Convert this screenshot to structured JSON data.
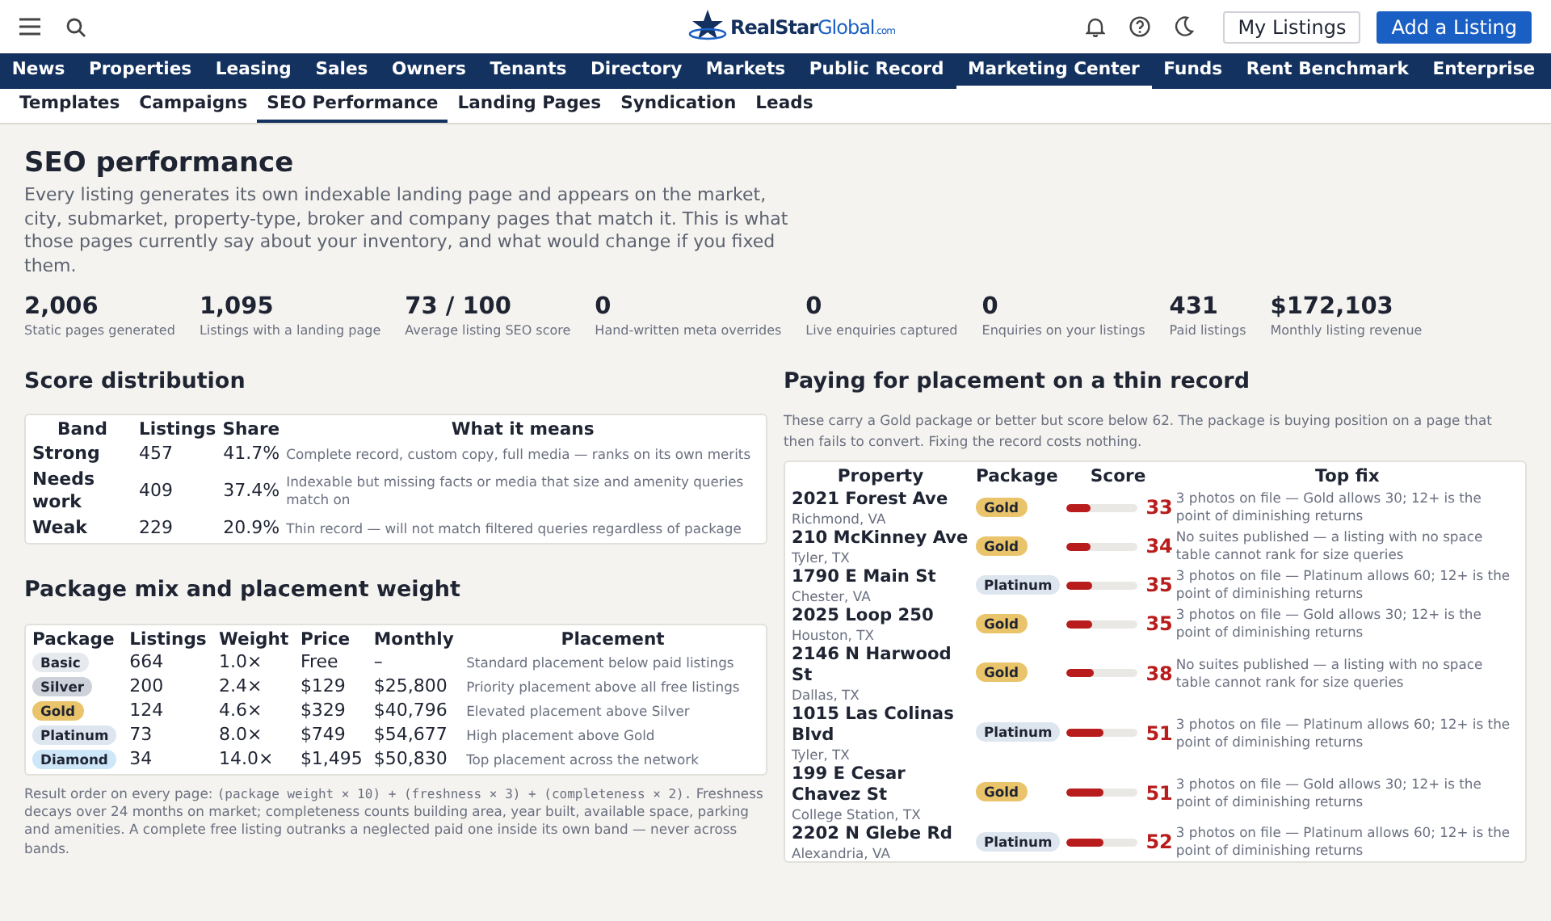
{
  "header": {
    "logo": {
      "name": "RealStar",
      "accent": "Global",
      "suffix": ".com"
    },
    "buttons": [
      {
        "label": "My Listings",
        "kind": "outline"
      },
      {
        "label": "Add a Listing",
        "kind": "primary"
      }
    ]
  },
  "nav": [
    {
      "label": "News",
      "selected": false
    },
    {
      "label": "Properties",
      "selected": false
    },
    {
      "label": "Leasing",
      "selected": false
    },
    {
      "label": "Sales",
      "selected": false
    },
    {
      "label": "Owners",
      "selected": false
    },
    {
      "label": "Tenants",
      "selected": false
    },
    {
      "label": "Directory",
      "selected": false
    },
    {
      "label": "Markets",
      "selected": false
    },
    {
      "label": "Public Record",
      "selected": false
    },
    {
      "label": "Marketing Center",
      "selected": true
    },
    {
      "label": "Funds",
      "selected": false
    },
    {
      "label": "Rent Benchmark",
      "selected": false
    },
    {
      "label": "Enterprise",
      "selected": false
    }
  ],
  "subnav": [
    {
      "label": "Templates",
      "selected": false
    },
    {
      "label": "Campaigns",
      "selected": false
    },
    {
      "label": "SEO Performance",
      "selected": true
    },
    {
      "label": "Landing Pages",
      "selected": false
    },
    {
      "label": "Syndication",
      "selected": false
    },
    {
      "label": "Leads",
      "selected": false
    }
  ],
  "page": {
    "title": "SEO performance",
    "description": "Every listing generates its own indexable landing page and appears on the market, city, submarket, property-type, broker and company pages that match it. This is what those pages currently say about your inventory, and what would change if you fixed them."
  },
  "stats": [
    {
      "value": "2,006",
      "label": "Static pages generated"
    },
    {
      "value": "1,095",
      "label": "Listings with a landing page"
    },
    {
      "value": "73 / 100",
      "label": "Average listing SEO score"
    },
    {
      "value": "0",
      "label": "Hand-written meta overrides"
    },
    {
      "value": "0",
      "label": "Live enquiries captured"
    },
    {
      "value": "0",
      "label": "Enquiries on your listings"
    },
    {
      "value": "431",
      "label": "Paid listings"
    },
    {
      "value": "$172,103",
      "label": "Monthly listing revenue"
    }
  ],
  "score_distribution": {
    "title": "Score distribution",
    "columns": [
      "Band",
      "Listings",
      "Share",
      "What it means"
    ],
    "rows": [
      {
        "band": "Strong",
        "listings": "457",
        "share": "41.7%",
        "meaning": "Complete record, custom copy, full media — ranks on its own merits"
      },
      {
        "band": "Needs work",
        "listings": "409",
        "share": "37.4%",
        "meaning": "Indexable but missing facts or media that size and amenity queries match on"
      },
      {
        "band": "Weak",
        "listings": "229",
        "share": "20.9%",
        "meaning": "Thin record — will not match filtered queries regardless of package"
      }
    ]
  },
  "package_mix": {
    "title": "Package mix and placement weight",
    "columns": [
      "Package",
      "Listings",
      "Weight",
      "Price",
      "Monthly",
      "Placement"
    ],
    "rows": [
      {
        "package": "Basic",
        "kind": "basic",
        "listings": "664",
        "weight": "1.0×",
        "price": "Free",
        "monthly": "–",
        "placement": "Standard placement below paid listings"
      },
      {
        "package": "Silver",
        "kind": "silver",
        "listings": "200",
        "weight": "2.4×",
        "price": "$129",
        "monthly": "$25,800",
        "placement": "Priority placement above all free listings"
      },
      {
        "package": "Gold",
        "kind": "gold",
        "listings": "124",
        "weight": "4.6×",
        "price": "$329",
        "monthly": "$40,796",
        "placement": "Elevated placement above Silver"
      },
      {
        "package": "Platinum",
        "kind": "platinum",
        "listings": "73",
        "weight": "8.0×",
        "price": "$749",
        "monthly": "$54,677",
        "placement": "High placement above Gold"
      },
      {
        "package": "Diamond",
        "kind": "diamond",
        "listings": "34",
        "weight": "14.0×",
        "price": "$1,495",
        "monthly": "$50,830",
        "placement": "Top placement across the network"
      }
    ],
    "note": {
      "lead": "Result order on every page:",
      "formula": "(package weight × 10) + (freshness × 3) + (completeness × 2).",
      "text": "Freshness decays over 24 months on market; completeness counts building area, year built, available space, parking and amenities. A complete free listing outranks a neglected paid one inside its own band — never across bands."
    }
  },
  "thin_records": {
    "title": "Paying for placement on a thin record",
    "description": "These carry a Gold package or better but score below 62. The package is buying position on a page that then fails to convert. Fixing the record costs nothing.",
    "columns": [
      "Property",
      "Package",
      "Score",
      "Top fix"
    ],
    "rows": [
      {
        "property": "2021 Forest Ave",
        "city": "Richmond, VA",
        "package": "Gold",
        "kind": "gold",
        "level": 0.33,
        "score": "33",
        "fix": "3 photos on file — Gold allows 30; 12+ is the point of diminishing returns"
      },
      {
        "property": "210 McKinney Ave",
        "city": "Tyler, TX",
        "package": "Gold",
        "kind": "gold",
        "level": 0.34,
        "score": "34",
        "fix": "No suites published — a listing with no space table cannot rank for size queries"
      },
      {
        "property": "1790 E Main St",
        "city": "Chester, VA",
        "package": "Platinum",
        "kind": "platinum",
        "level": 0.35,
        "score": "35",
        "fix": "3 photos on file — Platinum allows 60; 12+ is the point of diminishing returns"
      },
      {
        "property": "2025 Loop 250",
        "city": "Houston, TX",
        "package": "Gold",
        "kind": "gold",
        "level": 0.35,
        "score": "35",
        "fix": "3 photos on file — Gold allows 30; 12+ is the point of diminishing returns"
      },
      {
        "property": "2146 N Harwood St",
        "city": "Dallas, TX",
        "package": "Gold",
        "kind": "gold",
        "level": 0.38,
        "score": "38",
        "fix": "No suites published — a listing with no space table cannot rank for size queries"
      },
      {
        "property": "1015 Las Colinas Blvd",
        "city": "Tyler, TX",
        "package": "Platinum",
        "kind": "platinum",
        "level": 0.51,
        "score": "51",
        "fix": "3 photos on file — Platinum allows 60; 12+ is the point of diminishing returns"
      },
      {
        "property": "199 E Cesar Chavez St",
        "city": "College Station, TX",
        "package": "Gold",
        "kind": "gold",
        "level": 0.51,
        "score": "51",
        "fix": "3 photos on file — Gold allows 30; 12+ is the point of diminishing returns"
      },
      {
        "property": "2202 N Glebe Rd",
        "city": "Alexandria, VA",
        "package": "Platinum",
        "kind": "platinum",
        "level": 0.52,
        "score": "52",
        "fix": "3 photos on file — Platinum allows 60; 12+ is the point of diminishing returns"
      }
    ]
  }
}
